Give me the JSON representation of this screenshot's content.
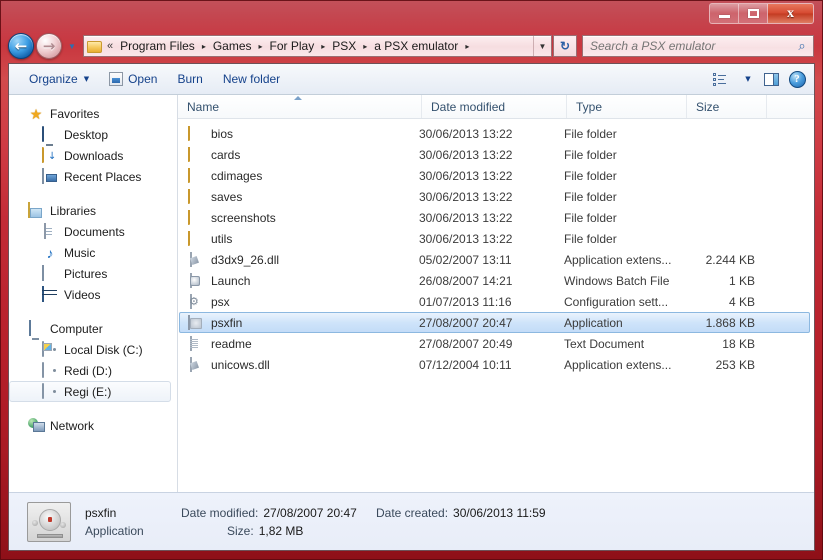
{
  "window": {
    "minimize_label": "Minimize",
    "maximize_label": "Maximize",
    "close_label": "Close"
  },
  "nav": {
    "back_glyph": "←",
    "forward_glyph": "→",
    "history_glyph": "▼",
    "refresh_glyph": "↻",
    "breadcrumb_prefix": "«",
    "breadcrumb": [
      "Program Files",
      "Games",
      "For Play",
      "PSX",
      "a PSX emulator"
    ],
    "crumb_arrow": "▸",
    "address_dropdown_glyph": "▼"
  },
  "search": {
    "placeholder": "Search a PSX emulator",
    "value": "",
    "icon_glyph": "⌕"
  },
  "toolbar": {
    "organize_label": "Organize",
    "organize_caret": "▼",
    "open_label": "Open",
    "burn_label": "Burn",
    "new_folder_label": "New folder",
    "view_caret": "▼",
    "help_glyph": "?"
  },
  "sidebar": {
    "groups": [
      {
        "header": "Favorites",
        "items": [
          {
            "label": "Desktop"
          },
          {
            "label": "Downloads"
          },
          {
            "label": "Recent Places"
          }
        ]
      },
      {
        "header": "Libraries",
        "items": [
          {
            "label": "Documents"
          },
          {
            "label": "Music"
          },
          {
            "label": "Pictures"
          },
          {
            "label": "Videos"
          }
        ]
      },
      {
        "header": "Computer",
        "items": [
          {
            "label": "Local Disk (C:)"
          },
          {
            "label": "Redi (D:)"
          },
          {
            "label": "Regi (E:)"
          }
        ]
      },
      {
        "header": "Network",
        "items": []
      }
    ],
    "download_arrow_glyph": "↓",
    "music_glyph": "♪",
    "star_glyph": "★"
  },
  "columns": {
    "name": "Name",
    "date_modified": "Date modified",
    "type": "Type",
    "size": "Size"
  },
  "files": [
    {
      "name": "bios",
      "date": "30/06/2013 13:22",
      "type": "File folder",
      "size": "",
      "icon": "folder-icon",
      "selected": false
    },
    {
      "name": "cards",
      "date": "30/06/2013 13:22",
      "type": "File folder",
      "size": "",
      "icon": "folder-icon",
      "selected": false
    },
    {
      "name": "cdimages",
      "date": "30/06/2013 13:22",
      "type": "File folder",
      "size": "",
      "icon": "folder-icon",
      "selected": false
    },
    {
      "name": "saves",
      "date": "30/06/2013 13:22",
      "type": "File folder",
      "size": "",
      "icon": "folder-icon",
      "selected": false
    },
    {
      "name": "screenshots",
      "date": "30/06/2013 13:22",
      "type": "File folder",
      "size": "",
      "icon": "folder-icon",
      "selected": false
    },
    {
      "name": "utils",
      "date": "30/06/2013 13:22",
      "type": "File folder",
      "size": "",
      "icon": "folder-icon",
      "selected": false
    },
    {
      "name": "d3dx9_26.dll",
      "date": "05/02/2007 13:11",
      "type": "Application extens...",
      "size": "2.244 KB",
      "icon": "dll-file-icon",
      "selected": false
    },
    {
      "name": "Launch",
      "date": "26/08/2007 14:21",
      "type": "Windows Batch File",
      "size": "1 KB",
      "icon": "batch-file-icon",
      "selected": false
    },
    {
      "name": "psx",
      "date": "01/07/2013 11:16",
      "type": "Configuration sett...",
      "size": "4 KB",
      "icon": "config-file-icon",
      "selected": false
    },
    {
      "name": "psxfin",
      "date": "27/08/2007 20:47",
      "type": "Application",
      "size": "1.868 KB",
      "icon": "application-icon",
      "selected": true
    },
    {
      "name": "readme",
      "date": "27/08/2007 20:49",
      "type": "Text Document",
      "size": "18 KB",
      "icon": "text-file-icon",
      "selected": false
    },
    {
      "name": "unicows.dll",
      "date": "07/12/2004 10:11",
      "type": "Application extens...",
      "size": "253 KB",
      "icon": "dll-file-icon",
      "selected": false
    }
  ],
  "details": {
    "name": "psxfin",
    "type": "Application",
    "date_modified_label": "Date modified:",
    "date_modified_value": "27/08/2007 20:47",
    "date_created_label": "Date created:",
    "date_created_value": "30/06/2013 11:59",
    "size_label": "Size:",
    "size_value": "1,82 MB"
  },
  "colors": {
    "frame": "#bf2630",
    "selection": "#cfe4fa",
    "header_text": "#34516e",
    "command_text": "#15428b"
  }
}
